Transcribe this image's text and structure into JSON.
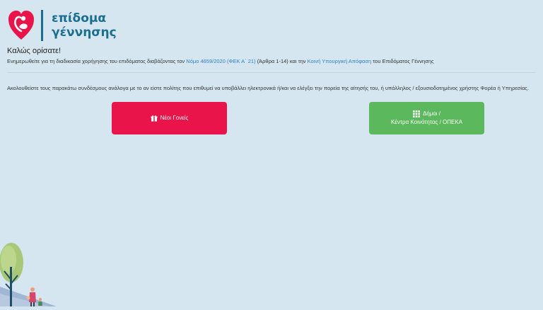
{
  "header": {
    "logo_line1": "επίδομα",
    "logo_line2": "γέννησης",
    "logo_icon": "heart-mother-child-icon"
  },
  "welcome": {
    "title": "Καλώς ορίσατε!",
    "intro_prefix": "Ενημερωθείτε για τη διαδικασία χορήγησης του επιδόματος διαβάζοντας τον",
    "law_link": "Νόμο 4659/2020 (ΦΕΚ Α΄ 21)",
    "articles_text": "(Άρθρα 1-14) και την",
    "decision_link": "Κοινή Υπουργική Απόφαση",
    "intro_suffix": "του Επιδόματος Γέννησης"
  },
  "instruction": "Ακολουθείστε τους παρακάτω συνδέσμους ανάλογα με το αν είστε πολίτης που επιθυμεί να υποβάλλει ηλεκτρονικά ή/και να ελέγξει την πορεία της αίτησής του, ή υπάλληλος / εξουσιοδοτημένος χρήστης Φορέα ή Υπηρεσίας.",
  "buttons": {
    "parents_label": "Νέοι Γονείς",
    "parents_icon": "gift-icon",
    "municipal_line1": "Δήμοι /",
    "municipal_line2": "Κέντρα Κοινότητας / ΟΠΕΚΑ",
    "municipal_icon": "grid-icon"
  },
  "colors": {
    "background": "#d6e6f0",
    "brand": "#1a6e8e",
    "logo_red": "#e8144a",
    "link": "#2f80c6",
    "parents_button": "#e8144a",
    "municipal_button": "#5cb85c"
  }
}
